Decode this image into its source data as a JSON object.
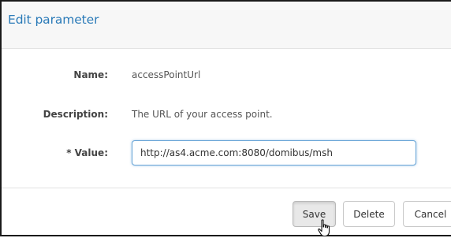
{
  "dialog": {
    "title": "Edit parameter"
  },
  "fields": {
    "name_label": "Name:",
    "name_value": "accessPointUrl",
    "description_label": "Description:",
    "description_value": "The URL of your access point.",
    "value_label": "* Value:",
    "value_input": "http://as4.acme.com:8080/domibus/msh"
  },
  "buttons": {
    "save": "Save",
    "delete": "Delete",
    "cancel": "Cancel"
  },
  "colors": {
    "title": "#2a7ab8",
    "input_focus_border": "#66a3d6"
  },
  "icons": {
    "cursor": "hand-pointer-icon"
  }
}
